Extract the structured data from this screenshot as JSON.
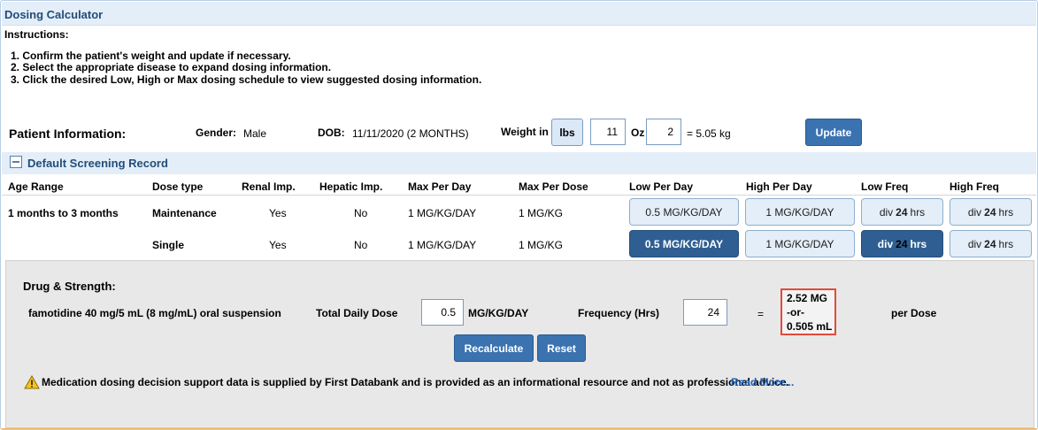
{
  "header": {
    "title": "Dosing Calculator"
  },
  "instructions": {
    "label": "Instructions:",
    "steps": [
      "1. Confirm the patient's weight and update if necessary.",
      "2. Select the appropriate disease to expand dosing information.",
      "3. Click the desired Low, High or Max dosing schedule to view suggested dosing information."
    ]
  },
  "patient": {
    "section_label": "Patient Information:",
    "gender_label": "Gender:",
    "gender_value": "Male",
    "dob_label": "DOB:",
    "dob_value": "11/11/2020 (2 MONTHS)",
    "weight_label": "Weight in",
    "unit_button": "lbs",
    "lbs_value": "11",
    "oz_label": "Oz",
    "oz_value": "2",
    "weight_kg": "= 5.05 kg",
    "update_button": "Update"
  },
  "record": {
    "title": "Default Screening Record",
    "columns": [
      "Age Range",
      "Dose type",
      "Renal Imp.",
      "Hepatic Imp.",
      "Max Per Day",
      "Max Per Dose",
      "Low Per Day",
      "High Per Day",
      "Low Freq",
      "High Freq"
    ],
    "rows": [
      {
        "age_range": "1 months to 3 months",
        "dose_type": "Maintenance",
        "renal": "Yes",
        "hepatic": "No",
        "max_per_day": "1 MG/KG/DAY",
        "max_per_dose": "1 MG/KG",
        "low_per_day": "0.5 MG/KG/DAY",
        "high_per_day": "1 MG/KG/DAY",
        "low_freq": {
          "prefix": "div",
          "num": "24",
          "suffix": "hrs"
        },
        "high_freq": {
          "prefix": "div",
          "num": "24",
          "suffix": "hrs"
        }
      },
      {
        "age_range": "",
        "dose_type": "Single",
        "renal": "Yes",
        "hepatic": "No",
        "max_per_day": "1 MG/KG/DAY",
        "max_per_dose": "1 MG/KG",
        "low_per_day": "0.5 MG/KG/DAY",
        "high_per_day": "1 MG/KG/DAY",
        "low_freq": {
          "prefix": "div",
          "num": "24",
          "suffix": "hrs"
        },
        "high_freq": {
          "prefix": "div",
          "num": "24",
          "suffix": "hrs"
        }
      }
    ]
  },
  "drug": {
    "label": "Drug & Strength:",
    "name": "famotidine 40 mg/5 mL (8 mg/mL) oral suspension",
    "total_daily_dose_label": "Total Daily Dose",
    "total_daily_dose_value": "0.5",
    "dose_unit": "MG/KG/DAY",
    "frequency_label": "Frequency (Hrs)",
    "frequency_value": "24",
    "equals": "=",
    "result_mg": "2.52 MG",
    "result_or": "-or-",
    "result_ml": "0.505 mL",
    "per_dose": "per Dose",
    "recalculate_button": "Recalculate",
    "reset_button": "Reset"
  },
  "disclaimer": {
    "text": "Medication dosing decision support data is supplied by First Databank and is provided as an informational resource and not as professional advice.",
    "link": "Read More..."
  },
  "colors": {
    "header_bg": "#e4eef8",
    "title_text": "#214d7a",
    "primary_button": "#3b72b0",
    "active_schedule": "#2f5f92",
    "result_border": "#e24a3b",
    "link": "#1f5fb4",
    "bottom_accent": "#f2b54e"
  },
  "icons": {
    "collapse": "minus-square-icon",
    "warning": "warning-triangle-icon"
  }
}
